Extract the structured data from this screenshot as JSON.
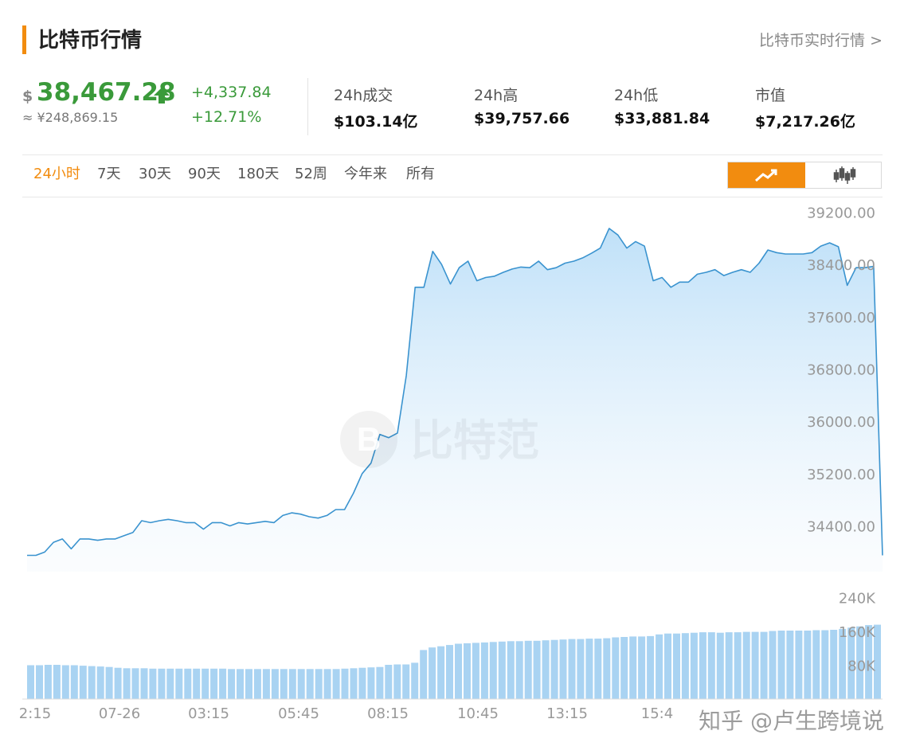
{
  "header": {
    "title": "比特币行情",
    "realtime_link": "比特币实时行情 >"
  },
  "price": {
    "currency": "$",
    "value": "38,467.28",
    "cny": "≈ ¥248,869.15",
    "change_abs": "+4,337.84",
    "change_pct": "+12.71%"
  },
  "stats": [
    {
      "label": "24h成交",
      "value": "$103.14亿"
    },
    {
      "label": "24h高",
      "value": "$39,757.66"
    },
    {
      "label": "24h低",
      "value": "$33,881.84"
    },
    {
      "label": "市值",
      "value": "$7,217.26亿"
    }
  ],
  "ranges": [
    "24小时",
    "7天",
    "30天",
    "90天",
    "180天",
    "52周",
    "今年来",
    "所有"
  ],
  "active_range": "24小时",
  "chart_modes": {
    "line": "line-chart-icon",
    "candle": "candlestick-icon",
    "active": "line"
  },
  "watermark": "比特范",
  "credit": "知乎 @卢生跨境说",
  "colors": {
    "accent": "#f28c0f",
    "up": "#3a9a3a",
    "line": "#3a93cf",
    "volume": "#a9d3f2",
    "axis_text": "#999999"
  },
  "chart_data": [
    {
      "type": "area",
      "ylim": [
        33700,
        39400
      ],
      "yticks": [
        "39200.00",
        "38400.00",
        "37600.00",
        "36800.00",
        "36000.00",
        "35200.00",
        "34400.00"
      ],
      "x": [
        "2:15",
        "07-26",
        "03:15",
        "05:45",
        "08:15",
        "10:45",
        "13:15",
        "15:4"
      ],
      "values": [
        33950,
        33950,
        34000,
        34150,
        34200,
        34050,
        34200,
        34200,
        34180,
        34200,
        34200,
        34250,
        34300,
        34480,
        34450,
        34480,
        34500,
        34480,
        34450,
        34450,
        34350,
        34450,
        34450,
        34400,
        34450,
        34430,
        34450,
        34470,
        34450,
        34560,
        34600,
        34580,
        34540,
        34520,
        34560,
        34650,
        34650,
        34900,
        35200,
        35360,
        35800,
        35750,
        35820,
        36700,
        38050,
        38050,
        38600,
        38400,
        38100,
        38350,
        38450,
        38150,
        38200,
        38220,
        38280,
        38330,
        38360,
        38350,
        38450,
        38320,
        38350,
        38420,
        38450,
        38500,
        38570,
        38650,
        38950,
        38850,
        38650,
        38750,
        38680,
        38150,
        38200,
        38050,
        38130,
        38130,
        38250,
        38280,
        38320,
        38230,
        38280,
        38320,
        38280,
        38420,
        38620,
        38580,
        38560,
        38560,
        38560,
        38580,
        38680,
        38730,
        38670,
        38080,
        38350,
        38350,
        38370,
        33950
      ]
    },
    {
      "type": "bar",
      "ylim": [
        0,
        260000
      ],
      "yticks": [
        "240K",
        "160K",
        "80K"
      ],
      "values": [
        80000,
        80000,
        81000,
        81000,
        80000,
        80000,
        79000,
        78000,
        77000,
        76000,
        74000,
        73000,
        73000,
        73000,
        72000,
        72000,
        72000,
        72000,
        72000,
        72000,
        72000,
        72000,
        72000,
        71000,
        71000,
        71000,
        71000,
        71000,
        71000,
        71000,
        71000,
        71000,
        71000,
        71000,
        71000,
        71000,
        72000,
        73000,
        74000,
        75000,
        76000,
        81000,
        82000,
        82000,
        86000,
        116000,
        122000,
        125000,
        128000,
        131000,
        132000,
        133000,
        134000,
        135000,
        136000,
        137000,
        137000,
        138000,
        138000,
        139000,
        140000,
        141000,
        142000,
        142000,
        143000,
        143000,
        144000,
        146000,
        147000,
        148000,
        148000,
        149000,
        153000,
        155000,
        155000,
        156000,
        157000,
        158000,
        158000,
        157000,
        158000,
        158000,
        159000,
        159000,
        159000,
        161000,
        162000,
        162000,
        162000,
        162000,
        163000,
        163000,
        164000,
        166000,
        169000,
        172000,
        175000,
        176000
      ]
    }
  ]
}
